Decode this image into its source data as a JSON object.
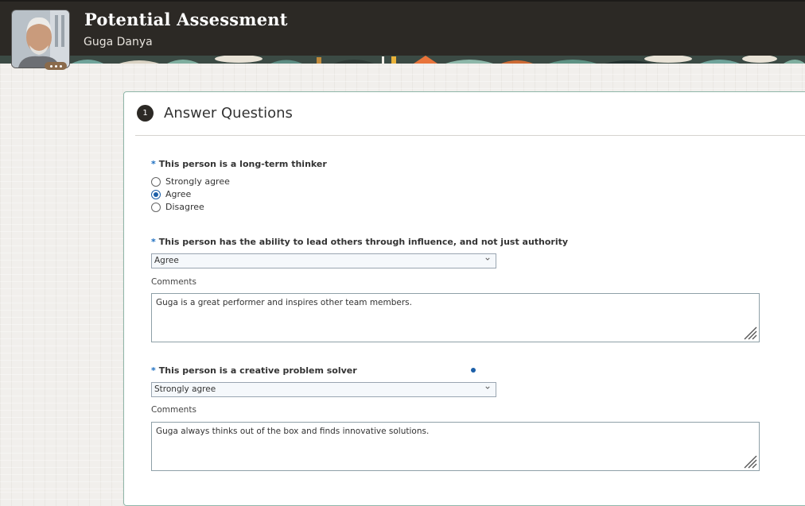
{
  "header": {
    "title": "Potential Assessment",
    "person_name": "Guga Danya"
  },
  "section": {
    "step_number": "1",
    "title": "Answer Questions"
  },
  "questions": [
    {
      "required_marker": "*",
      "label": "This person is a long-term thinker",
      "type": "radio",
      "options": [
        "Strongly agree",
        "Agree",
        "Disagree"
      ],
      "selected": "Agree"
    },
    {
      "required_marker": "*",
      "label": "This person has the ability to lead others through influence, and not just authority",
      "type": "select",
      "value": "Agree",
      "comments_label": "Comments",
      "comments": "Guga is a great performer and inspires other team members."
    },
    {
      "required_marker": "*",
      "label": "This person is a creative problem solver",
      "type": "select",
      "value": "Strongly agree",
      "comments_label": "Comments",
      "comments": "Guga always thinks out of the box and finds innovative solutions."
    }
  ],
  "colors": {
    "header_bg": "#2c2925",
    "accent": "#1c5fa8",
    "card_border": "#8fb6a9"
  },
  "icons": {
    "avatar_more": "more-dots-icon",
    "select_chevron": "chevron-down-icon",
    "resize": "resize-grip-icon"
  }
}
